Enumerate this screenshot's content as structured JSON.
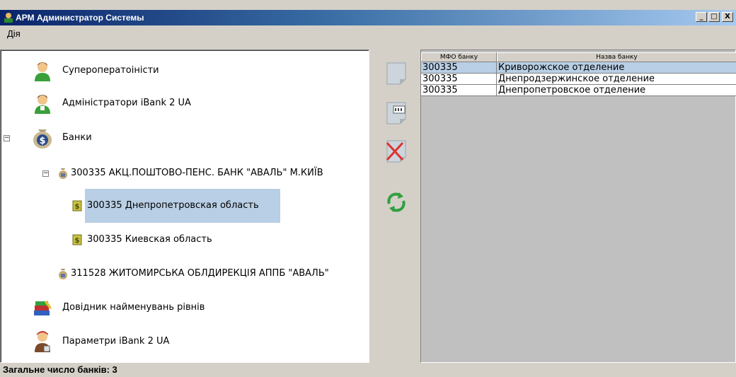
{
  "window": {
    "title": "АРМ Администратор Системы",
    "minimize": "_",
    "maximize": "□",
    "close": "X"
  },
  "menu": {
    "items": [
      {
        "label": "Дія"
      }
    ]
  },
  "tree": {
    "items": [
      {
        "label": "Супероператоіністи"
      },
      {
        "label": "Адміністратори iBank 2 UA"
      },
      {
        "label": "Банки",
        "expander": "−"
      },
      {
        "label": "300335 АКЦ.ПОШТОВО-ПЕНС. БАНК \"АВАЛЬ\" М.КИЇВ",
        "expander": "−"
      },
      {
        "label": "300335 Днепропетровская область"
      },
      {
        "label": "300335 Киевская область"
      },
      {
        "label": "311528 ЖИТОМИРСЬКА ОБЛДИРЕКЦІЯ АППБ \"АВАЛЬ\""
      },
      {
        "label": "Довідник найменувань рівнів"
      },
      {
        "label": "Параметри iBank 2 UA"
      }
    ]
  },
  "table": {
    "columns": [
      "МФО банку",
      "Назва банку"
    ],
    "rows": [
      [
        "300335",
        "Криворожское отделение"
      ],
      [
        "300335",
        "Днепродзержинское отделение"
      ],
      [
        "300335",
        "Днепропетровское отделение"
      ]
    ]
  },
  "status": {
    "text": "Загальне число банків: 3"
  },
  "colors": {
    "selection": "#b8cfe5",
    "title_start": "#0a246a",
    "title_end": "#a6caf0"
  },
  "icons": {
    "toolbar": [
      "new-document-icon",
      "edit-document-icon",
      "delete-document-icon",
      "refresh-icon"
    ]
  }
}
